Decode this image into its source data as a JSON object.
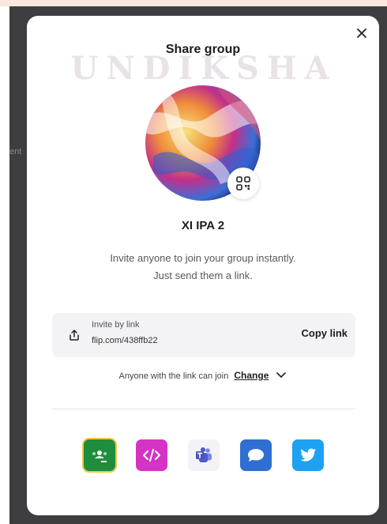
{
  "backdrop": {
    "peek_text": "ent"
  },
  "watermark": {
    "text": "UNDIKSHA"
  },
  "modal": {
    "title": "Share group",
    "group_name": "XI IPA 2",
    "description_line1": "Invite anyone to join your group instantly.",
    "description_line2": "Just send them a link."
  },
  "invite": {
    "label": "Invite by link",
    "url": "flip.com/438ffb22",
    "copy_label": "Copy link"
  },
  "permission": {
    "text": "Anyone with the link can join",
    "change_label": "Change"
  },
  "share_apps": [
    {
      "name": "Google Classroom",
      "icon": "google-classroom-icon",
      "color": "#1e8e3e"
    },
    {
      "name": "Embed code",
      "icon": "embed-code-icon",
      "color": "#d533c4"
    },
    {
      "name": "Microsoft Teams",
      "icon": "microsoft-teams-icon",
      "color": "#5059c9"
    },
    {
      "name": "Remind",
      "icon": "remind-icon",
      "color": "#2f6fd1"
    },
    {
      "name": "Twitter",
      "icon": "twitter-icon",
      "color": "#1da1f2"
    }
  ],
  "colors": {
    "backdrop": "#3e3e40",
    "modal_bg": "#ffffff",
    "invite_box_bg": "#f3f3f5",
    "classroom_border": "#f4c542"
  }
}
